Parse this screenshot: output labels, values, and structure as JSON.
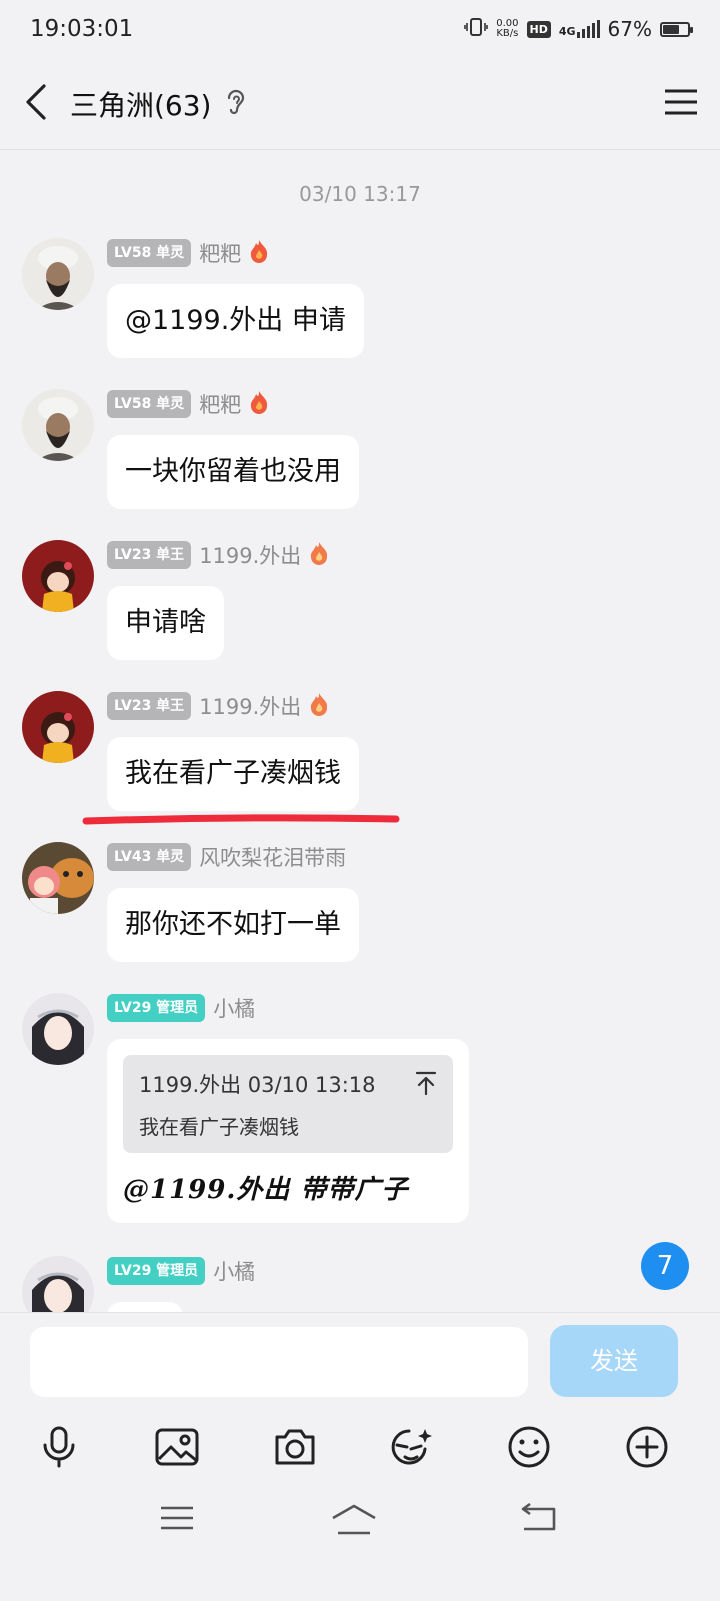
{
  "status_bar": {
    "time": "19:03:01",
    "net_speed_value": "0.00",
    "net_speed_unit": "KB/s",
    "hd": "HD",
    "network": "4G",
    "battery_text": "67%",
    "battery_level": 0.67
  },
  "header": {
    "title": "三角洲(63)"
  },
  "chat": {
    "timestamp": "03/10 13:17",
    "messages": [
      {
        "badge": "LV58 单灵",
        "nick": "粑粑",
        "text": "@1199.外出 申请"
      },
      {
        "badge": "LV58 单灵",
        "nick": "粑粑",
        "text": "一块你留着也没用"
      },
      {
        "badge": "LV23 单王",
        "nick": "1199.外出",
        "text": "申请啥"
      },
      {
        "badge": "LV23 单王",
        "nick": "1199.外出",
        "text": "我在看广子凑烟钱"
      },
      {
        "badge": "LV43 单灵",
        "nick": "风吹梨花泪带雨",
        "text": "那你还不如打一单"
      },
      {
        "badge": "LV29 管理员",
        "nick": "小橘",
        "quote_head": "1199.外出 03/10 13:18",
        "quote_text": "我在看广子凑烟钱",
        "text": "@1199.外出 带带广子"
      },
      {
        "badge": "LV29 管理员",
        "nick": "小橘"
      }
    ],
    "unread_count": "7"
  },
  "composer": {
    "input_value": "",
    "send_label": "发送"
  },
  "colors": {
    "background": "#f2f2f4",
    "admin_badge": "#43cfc4",
    "level_badge": "#b5b5b8",
    "send_button": "#a6d6f8",
    "unread_badge": "#1e8ff0",
    "highlight_underline": "#ee2b3b"
  },
  "icons": {
    "toolbar": [
      "microphone-icon",
      "image-icon",
      "camera-icon",
      "sticker-face-icon",
      "emoji-icon",
      "plus-icon"
    ],
    "system_nav": [
      "menu-lines-icon",
      "home-icon",
      "back-icon"
    ]
  }
}
